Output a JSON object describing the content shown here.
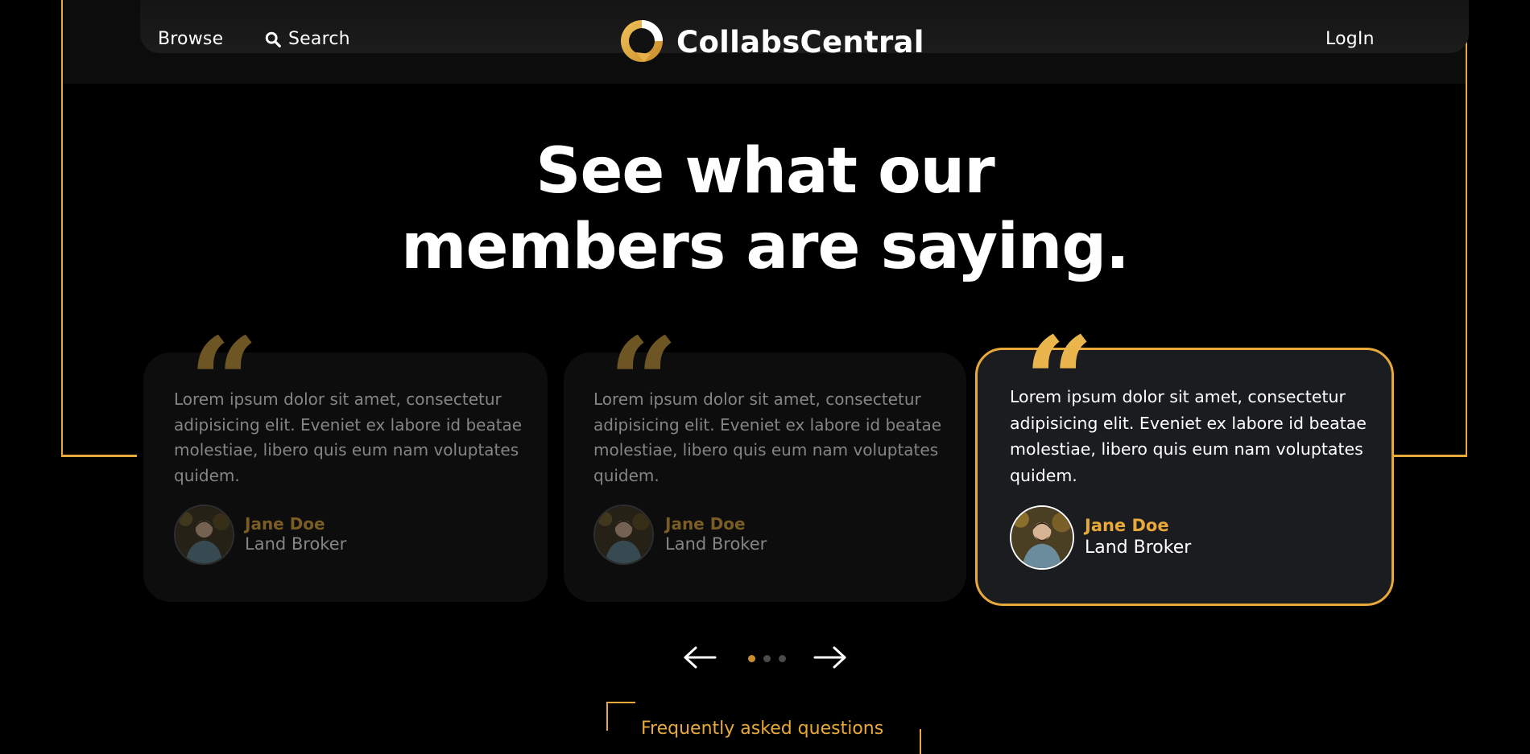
{
  "nav": {
    "browse": "Browse",
    "search": "Search",
    "brand": "CollabsCentral",
    "login": "LogIn"
  },
  "heading": {
    "line1": "See what our",
    "line2": "members are saying."
  },
  "testimonials": [
    {
      "quote": "Lorem ipsum dolor sit amet, consectetur adipisicing elit. Eveniet ex labore id beatae molestiae, libero quis eum nam voluptates quidem.",
      "name": "Jane Doe",
      "role": "Land Broker",
      "active": false
    },
    {
      "quote": "Lorem ipsum dolor sit amet, consectetur adipisicing elit. Eveniet ex labore id beatae molestiae, libero quis eum nam voluptates quidem.",
      "name": "Jane Doe",
      "role": "Land Broker",
      "active": false
    },
    {
      "quote": "Lorem ipsum dolor sit amet, consectetur adipisicing elit. Eveniet ex labore id beatae molestiae, libero quis eum nam voluptates quidem.",
      "name": "Jane Doe",
      "role": "Land Broker",
      "active": true
    }
  ],
  "slider": {
    "dot_count": 3,
    "active_dot": 0
  },
  "faq": {
    "label": "Frequently asked questions"
  },
  "colors": {
    "accent": "#e9a93a",
    "background": "#000000",
    "card_active": "#1a1c20"
  },
  "icons": {
    "search": "search-icon",
    "prev": "arrow-left-icon",
    "next": "arrow-right-icon",
    "quote": "quote-icon",
    "logo": "logo-icon"
  }
}
